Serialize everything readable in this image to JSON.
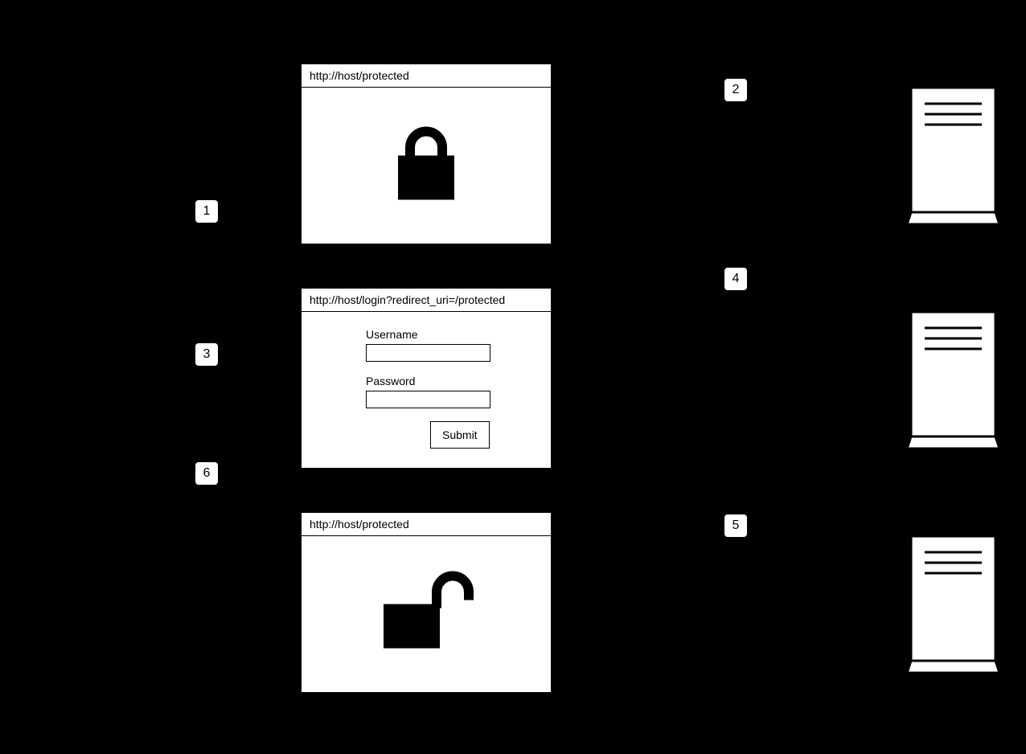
{
  "browsers": {
    "protected1": {
      "url": "http://host/protected"
    },
    "login": {
      "url": "http://host/login?redirect_uri=/protected",
      "username_label": "Username",
      "password_label": "Password",
      "submit_label": "Submit"
    },
    "protected2": {
      "url": "http://host/protected"
    }
  },
  "steps": {
    "s1": "1",
    "s2": "2",
    "s3": "3",
    "s4": "4",
    "s5": "5",
    "s6": "6"
  }
}
